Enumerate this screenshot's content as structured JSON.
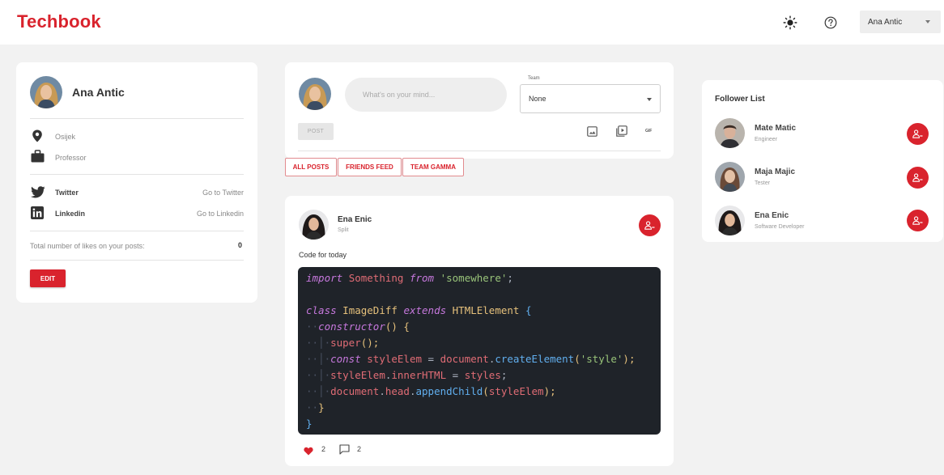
{
  "app": {
    "brand": "Techbook"
  },
  "header": {
    "user_select": "Ana Antic"
  },
  "profile": {
    "name": "Ana Antic",
    "location": "Osijek",
    "occupation": "Professor",
    "socials": [
      {
        "label": "Twitter",
        "link_text": "Go to Twitter"
      },
      {
        "label": "Linkedin",
        "link_text": "Go to Linkedin"
      }
    ],
    "likes_label": "Total number of likes on your posts:",
    "likes_value": "0",
    "edit_label": "EDIT"
  },
  "composer": {
    "placeholder": "What's on your mind...",
    "team_label": "Team",
    "team_value": "None",
    "post_label": "POST",
    "gif_label": "GIF"
  },
  "feed_tabs": [
    "ALL POSTS",
    "FRIENDS FEED",
    "TEAM GAMMA"
  ],
  "post": {
    "author": "Ena Enic",
    "location": "Split",
    "text": "Code for today",
    "likes": "2",
    "comments": "2"
  },
  "followers": {
    "title": "Follower List",
    "items": [
      {
        "name": "Mate Matic",
        "role": "Engineer"
      },
      {
        "name": "Maja Majic",
        "role": "Tester"
      },
      {
        "name": "Ena Enic",
        "role": "Software Developer"
      }
    ]
  },
  "colors": {
    "accent": "#d9232d",
    "code_bg": "#1f2329"
  },
  "icons": [
    "sun-icon",
    "help-icon",
    "location-pin-icon",
    "briefcase-icon",
    "twitter-icon",
    "linkedin-icon",
    "image-icon",
    "video-icon",
    "remove-user-icon",
    "heart-icon",
    "comment-icon"
  ]
}
